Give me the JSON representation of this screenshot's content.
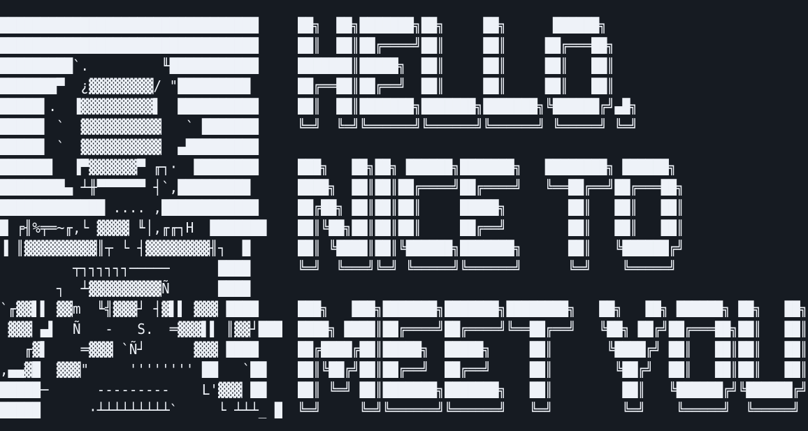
{
  "colors": {
    "background": "#161b22",
    "foreground": "#eef2f8"
  },
  "art": {
    "lines": [
      "████████████████████████████████",
      "████████████████████████████████",
      "█████████`.         ╙███████████",
      "███████▀  ¿▓▓▓▓▓▓▓▓/ \"█████████",
      "█████▌.  ▐▓▓▓▓▓▓▓▓▓▌  ██████████",
      "█████▌ `  ▓▓▓▓▓▓▓▓▓▓   ` ███████",
      "█████▌ `  ▓▓▓▓▓▓▓▓▓▓  ▄█████████",
      "██████▌  ▐▀▓▓▓▓▓▓▀ ╓┐·  ████████",
      "████████▄ ┴╫▀▀▀▀▀▀ ┤`,█████████",
      "█████████████ .... ,████████████",
      "█ ╒╢%╤═~╓,└ ▓▓▓▓ ╙│,╓╓┐H  ███████",
      "▐ ║▓▓▓▓▓▓▓▓▓║┬ └ ┤▓▓▓▓▓▓▓▓╢┐  █",
      "         ┬┐┐┐┐┐┐─────      ████",
      "       ┐  ┴▓▓▓▓▓▓▓▓▓Ñ      ████",
      "`╓▓▓▌▌ ▓▓m  ╙╣▓▓▓┘ ┤▓▌▌ ▓▓▓ ████",
      " ▓▓▓ ▄▌  Ñ   -   S.  ═▓▓▓▌▌ ║▓▓┘███",
      "   ╓▓▌    ═▓▓▓ `Ñ┘      ▓▓▓ ████",
      ",▄▄▓█  ▓▓▓\"     '''''''' ██   `██",
      "█████─      ---------    L'▓▓▓ ██",
      "█████      ·┴┴┴┴┴┴┴┴┴`     └ ┴┴┴_ █"
    ]
  },
  "banner": {
    "words": [
      "HELLO,",
      "NICE TO",
      "MEET YOU"
    ],
    "lines": [
      "██╗  ██╗███████╗██╗     ██╗      ██████╗",
      "██║  ██║██╔════╝██║     ██║     ██╔═══██╗",
      "███████║█████╗  ██║     ██║     ██║   ██║",
      "██╔══██║██╔══╝  ██║     ██║     ██║   ██║",
      "██║  ██║███████╗███████╗███████╗╚██████╔╝▄█╗",
      "╚═╝  ╚═╝╚══════╝╚══════╝╚══════╝ ╚═════╝ ╚═╝",
      "",
      "███╗   ██╗██╗ ██████╗███████╗   ████████╗ ██████╗",
      "████╗  ██║██║██╔════╝██╔════╝   ╚══██╔══╝██╔═══██╗",
      "██╔██╗ ██║██║██║     █████╗        ██║   ██║   ██║",
      "██║╚██╗██║██║██║     ██╔══╝        ██║   ██║   ██║",
      "██║ ╚████║██║╚██████╗███████╗      ██║   ╚██████╔╝",
      "╚═╝  ╚═══╝╚═╝ ╚═════╝╚══════╝      ╚═╝    ╚═════╝",
      "",
      "███╗   ███╗███████╗███████╗████████╗   ██╗   ██╗ ██████╗ ██╗   ██╗",
      "████╗ ████║██╔════╝██╔════╝╚══██╔══╝   ╚██╗ ██╔╝██╔═══██╗██║   ██║",
      "██╔████╔██║█████╗  █████╗     ██║       ╚████╔╝ ██║   ██║██║   ██║",
      "██║╚██╔╝██║██╔══╝  ██╔══╝     ██║        ╚██╔╝  ██║   ██║██║   ██║",
      "██║ ╚═╝ ██║███████╗███████╗   ██║         ██║   ╚██████╔╝╚██████╔╝",
      "╚═╝     ╚═╝╚══════╝╚══════╝   ╚═╝         ╚═╝    ╚═════╝  ╚═════╝"
    ]
  }
}
